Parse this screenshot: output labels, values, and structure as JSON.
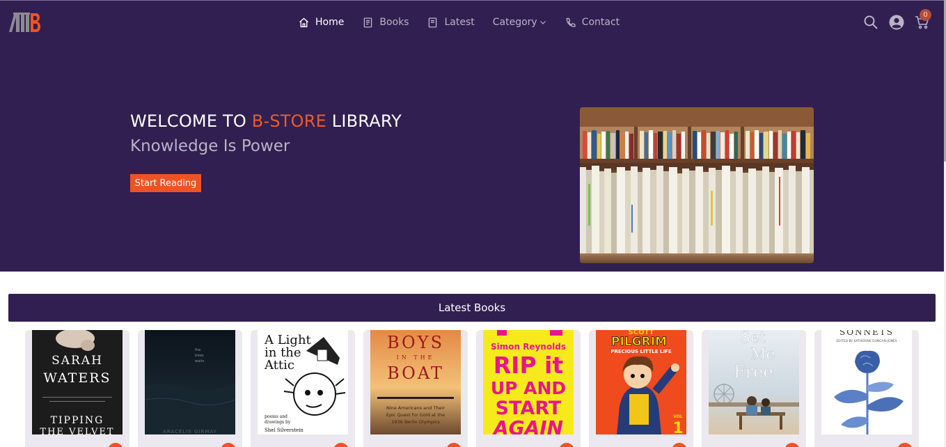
{
  "header": {
    "nav": [
      {
        "label": "Home",
        "icon": "home-icon",
        "active": true
      },
      {
        "label": "Books",
        "icon": "book-icon",
        "active": false
      },
      {
        "label": "Latest",
        "icon": "book-open-icon",
        "active": false
      },
      {
        "label": "Category",
        "icon": "chevron-down-icon",
        "active": false
      },
      {
        "label": "Contact",
        "icon": "phone-icon",
        "active": false
      }
    ],
    "cart_count": "0"
  },
  "hero": {
    "title_before": "WELCOME TO ",
    "title_brand": "B-STORE",
    "title_after": " LIBRARY",
    "subtitle": "Knowledge Is Power",
    "cta_label": "Start Reading"
  },
  "latest": {
    "heading": "Latest Books",
    "books": [
      {
        "cover_lines": [
          "SARAH",
          "WATERS",
          "TIPPING",
          "THE VELVET"
        ]
      },
      {
        "cover_lines": [
          "the",
          "trees",
          "waits",
          "ARACELIS GIRMAY"
        ]
      },
      {
        "cover_lines": [
          "A Light",
          "in the",
          "Attic",
          "poems and",
          "drawings by",
          "Shel Silverstein"
        ]
      },
      {
        "cover_lines": [
          "BOYS",
          "IN THE",
          "BOAT",
          "Nine Americans and Their",
          "Epic Quest for Gold at the",
          "1936 Berlin Olympics"
        ]
      },
      {
        "cover_lines": [
          "Simon Reynolds",
          "RIP it",
          "UP AND",
          "START",
          "AGAIN"
        ]
      },
      {
        "cover_lines": [
          "SCOTT",
          "PILGRIM",
          "PRECIOUS LITTLE LIFE",
          "VOL",
          "1"
        ]
      },
      {
        "cover_lines": [
          "Set",
          "Me",
          "Free"
        ]
      },
      {
        "cover_lines": [
          "SONNETS",
          "EDITED BY KATHERINE DUNCAN-JONES"
        ]
      }
    ]
  },
  "colors": {
    "brand_purple": "#311f51",
    "accent_orange": "#ee5324",
    "muted_text": "#b9b3c8"
  }
}
